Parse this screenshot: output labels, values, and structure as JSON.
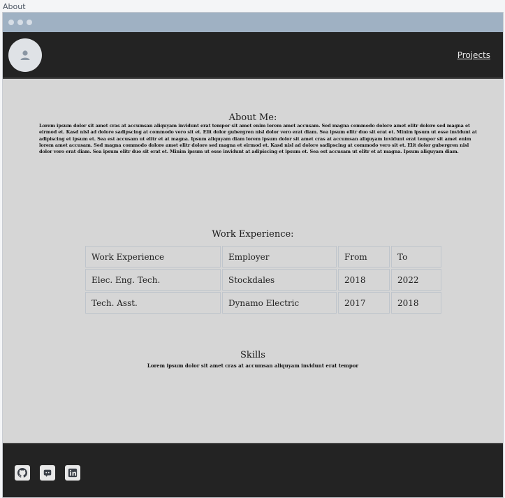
{
  "tab_title": "About",
  "nav": {
    "projects_link": "Projects"
  },
  "about": {
    "title": "About Me:",
    "text": "Lorem ipsum dolor sit amet cras at accumsan aliquyam invidunt erat tempor sit amet enim lorem amet accusam. Sed magna commodo dolore amet elitr dolore sed magna et eirmod et. Kasd nisl ad dolore sadipscing at commodo vero sit et. Elit dolor gubergren nisl dolor vero erat diam. Sea ipsum elitr duo sit erat et. Minim ipsum ut esse invidunt at adipiscing et ipsum et. Sea est accusam ut elitr et at magna. Ipsum aliquyam diam lorem ipsum dolor sit amet cras at accumsan aliquyam invidunt erat tempor sit amet enim lorem amet accusam. Sed magna commodo dolore amet elitr dolore sed magna et eirmod et. Kasd nisl ad dolore sadipscing at commodo vero sit et. Elit dolor gubergren nisl dolor vero erat diam. Sea ipsum elitr duo sit erat et. Minim ipsum ut esse invidunt at adipiscing et ipsum et. Sea est accusam ut elitr et at magna. Ipsum aliquyam diam."
  },
  "work": {
    "title": "Work Experience:",
    "headers": [
      "Work Experience",
      "Employer",
      "From",
      "To"
    ],
    "rows": [
      [
        "Elec. Eng. Tech.",
        "Stockdales",
        "2018",
        "2022"
      ],
      [
        "Tech. Asst.",
        "Dynamo Electric",
        "2017",
        "2018"
      ]
    ]
  },
  "skills": {
    "title": "Skills",
    "text": "Lorem ipsum dolor sit amet cras at accumsan aliquyam invidunt erat tempor"
  },
  "footer": {
    "icons": [
      "github-icon",
      "discord-icon",
      "linkedin-icon"
    ]
  }
}
